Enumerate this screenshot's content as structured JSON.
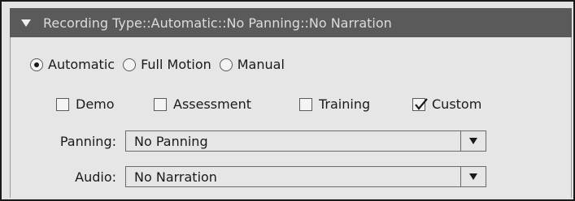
{
  "header": {
    "title": "Recording Type::Automatic::No Panning::No Narration",
    "collapse_icon": "triangle-down-icon"
  },
  "recording_mode": {
    "options": [
      {
        "label": "Automatic",
        "selected": true
      },
      {
        "label": "Full Motion",
        "selected": false
      },
      {
        "label": "Manual",
        "selected": false
      }
    ]
  },
  "modes": {
    "items": [
      {
        "label": "Demo",
        "checked": false
      },
      {
        "label": "Assessment",
        "checked": false
      },
      {
        "label": "Training",
        "checked": false
      },
      {
        "label": "Custom",
        "checked": true
      }
    ]
  },
  "panning": {
    "label": "Panning:",
    "value": "No Panning"
  },
  "audio": {
    "label": "Audio:",
    "value": "No Narration"
  }
}
